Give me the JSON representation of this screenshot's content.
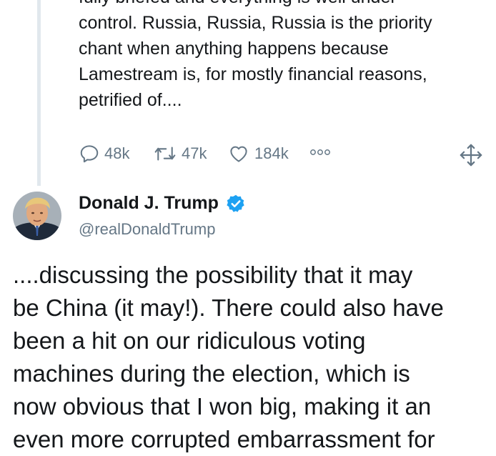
{
  "previous_tweet": {
    "text_lines": [
      "fully briefed and everything is well under",
      "control. Russia, Russia, Russia is the priority",
      "chant when anything happens because",
      "Lamestream is, for mostly financial reasons,",
      "petrified of...."
    ],
    "replies": "48k",
    "retweets": "47k",
    "likes": "184k"
  },
  "tweet": {
    "author_name": "Donald J. Trump",
    "handle": "@realDonaldTrump",
    "text_lines": [
      "....discussing the possibility that it may",
      "be China (it may!). There could also have",
      "been a hit on our ridiculous voting",
      "machines during the election, which is",
      "now obvious that I won big, making it an",
      "even more corrupted embarrassment for"
    ]
  },
  "colors": {
    "secondary_text": "#657786",
    "verified_blue": "#1da1f2",
    "thread_line": "#e1e8ed"
  },
  "icons": [
    "reply-icon",
    "retweet-icon",
    "like-icon",
    "more-icon",
    "expand-icon",
    "verified-badge-icon"
  ]
}
